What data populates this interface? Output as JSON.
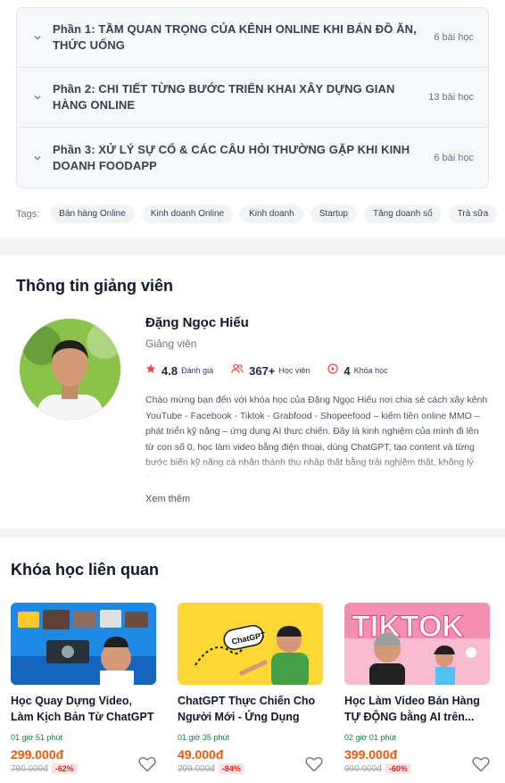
{
  "curriculum": {
    "sections": [
      {
        "title": "Phần 1: TẦM QUAN TRỌNG CỦA KÊNH ONLINE KHI BÁN ĐỒ ĂN, THỨC UỐNG",
        "count": "6 bài học"
      },
      {
        "title": "Phần 2: CHI TIẾT TỪNG BƯỚC TRIỂN KHAI XÂY DỰNG GIAN HÀNG ONLINE",
        "count": "13 bài học"
      },
      {
        "title": "Phần 3: XỬ LÝ SỰ CỐ & CÁC CÂU HỎI THƯỜNG GẶP KHI KINH DOANH FOODAPP",
        "count": "6 bài học"
      }
    ]
  },
  "tags": {
    "label": "Tags:",
    "items": [
      "Bán hàng Online",
      "Kinh doanh Online",
      "Kinh doanh",
      "Startup",
      "Tăng doanh số",
      "Trà sữa"
    ]
  },
  "instructor": {
    "section_title": "Thông tin giảng viên",
    "name": "Đặng Ngọc Hiếu",
    "role": "Giảng viên",
    "rating": "4.8",
    "rating_label": "Đánh giá",
    "students": "367+",
    "students_label": "Học viên",
    "courses": "4",
    "courses_label": "Khóa học",
    "bio": "Chào mừng bạn đến với khóa học của Đặng Ngọc Hiếu nơi chia sẻ cách xây kênh YouTube - Facebook - Tiktok - Grabfood - Shopeefood – kiếm tiền online MMO – phát triển kỹ năng – ứng dụng AI thực chiến. Đây là kinh nghiệm của mình đi lên từ con số 0, học làm video bằng điện thoại, dùng ChatGPT, tạo content và từng bước biến kỹ năng cá nhân thành thu nhập thật bằng trải nghiệm thật, không lý thuyết.",
    "more": "Xem thêm"
  },
  "related": {
    "section_title": "Khóa học liên quan",
    "courses": [
      {
        "title": "Học Quay Dựng Video, Làm Kịch Bản Từ ChatGPT Trê...",
        "duration": "01 giờ 51 phút",
        "price": "299.000đ",
        "old_price": "790.000đ",
        "discount": "-62%"
      },
      {
        "title": "ChatGPT Thực Chiến Cho Người Mới - Ứng Dụng Và...",
        "duration": "01 giờ 35 phút",
        "price": "49.000đ",
        "old_price": "299.000đ",
        "discount": "-84%"
      },
      {
        "title": "Học Làm Video Bán Hàng TỰ ĐỘNG bằng AI trên...",
        "duration": "02 giờ 01 phút",
        "price": "399.000đ",
        "old_price": "990.000đ",
        "discount": "-60%"
      }
    ],
    "thumb_texts": [
      "ChatGPT",
      "TIKTOK"
    ]
  },
  "colors": {
    "accent": "#ea580c",
    "star": "#ef4444",
    "green": "#15803d"
  }
}
